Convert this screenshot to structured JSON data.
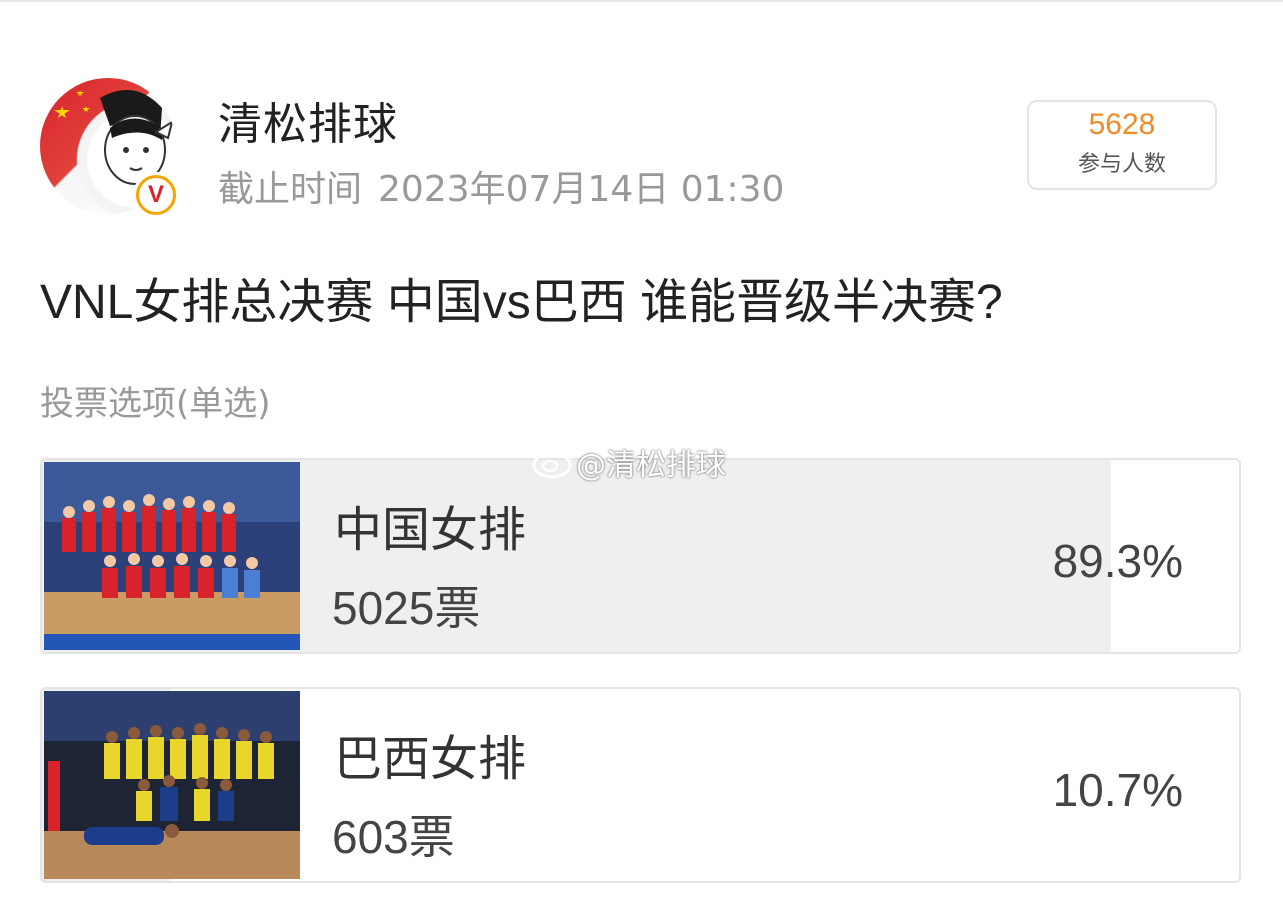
{
  "header": {
    "username": "清松排球",
    "deadline_label": "截止时间",
    "deadline_value": "2023年07月14日 01:30",
    "participants_count": "5628",
    "participants_label": "参与人数"
  },
  "poll": {
    "question": "VNL女排总决赛 中国vs巴西 谁能晋级半决赛?",
    "vote_type": "投票选项(单选)",
    "watermark": "@清松排球",
    "options": [
      {
        "name": "中国女排",
        "votes": "5025票",
        "percent_text": "89.3%",
        "percent": 89.3,
        "photo": "china-team-photo"
      },
      {
        "name": "巴西女排",
        "votes": "603票",
        "percent_text": "10.7%",
        "percent": 10.7,
        "photo": "brazil-team-photo"
      }
    ]
  },
  "colors": {
    "accent": "#f08b29",
    "bar": "#efefef",
    "border": "#e4e4e4",
    "muted": "#999999",
    "badge": "#f5a400"
  },
  "icons": {
    "verified": "verified-badge-icon",
    "weibo": "weibo-logo-icon"
  }
}
